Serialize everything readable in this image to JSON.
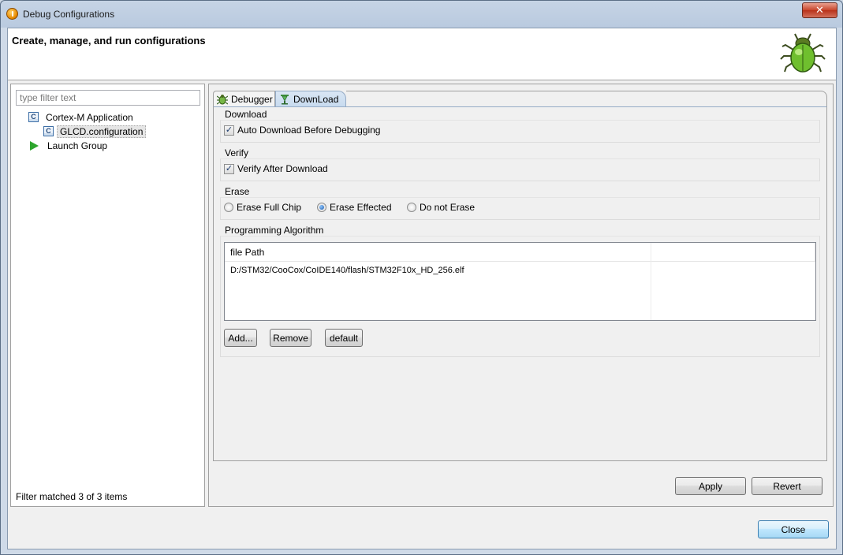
{
  "window": {
    "title": "Debug Configurations",
    "close_glyph": "✕"
  },
  "header": {
    "title": "Create, manage, and run configurations",
    "logo_icon": "bug-icon"
  },
  "left": {
    "filter_placeholder": "type filter text",
    "tree": [
      {
        "label": "Cortex-M Application",
        "icon": "c-config-icon",
        "level": 0
      },
      {
        "label": "GLCD.configuration",
        "icon": "c-config-icon",
        "level": 1,
        "selected": true
      },
      {
        "label": "Launch Group",
        "icon": "launch-group-icon",
        "level": 0
      }
    ],
    "status": "Filter matched 3 of 3 items"
  },
  "tabs": [
    {
      "label": "Debugger",
      "icon": "debugger-bug-icon",
      "active": false
    },
    {
      "label": "DownLoad",
      "icon": "download-icon",
      "active": true
    }
  ],
  "download": {
    "title": "Download",
    "auto_download_label": "Auto Download Before Debugging",
    "auto_download_checked": true
  },
  "verify": {
    "title": "Verify",
    "verify_label": "Verify After Download",
    "verify_checked": true
  },
  "erase": {
    "title": "Erase",
    "options": [
      "Erase Full Chip",
      "Erase Effected",
      "Do not Erase"
    ],
    "selected": "Erase Effected"
  },
  "algorithm": {
    "title": "Programming Algorithm",
    "columns": [
      "file Path",
      ""
    ],
    "rows": [
      [
        "D:/STM32/CooCox/CoIDE140/flash/STM32F10x_HD_256.elf",
        ""
      ]
    ],
    "add_label": "Add...",
    "remove_label": "Remove",
    "default_label": "default"
  },
  "footer": {
    "apply_label": "Apply",
    "revert_label": "Revert",
    "close_label": "Close"
  },
  "colors": {
    "selected_tab": "#c8dbef",
    "window_frame": "#b9cadf",
    "launch_icon": "#2da52d"
  }
}
